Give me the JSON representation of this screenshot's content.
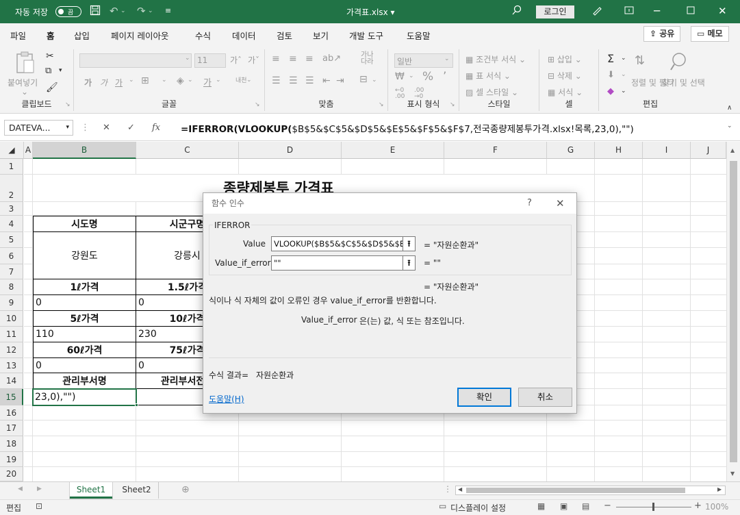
{
  "titlebar": {
    "autosave_label": "자동 저장",
    "autosave_state": "끔",
    "file_title": "가격표.xlsx ▾",
    "login_label": "로그인",
    "accent": "#217346"
  },
  "menu": {
    "tabs": [
      "파일",
      "홈",
      "삽입",
      "페이지 레이아웃",
      "수식",
      "데이터",
      "검토",
      "보기",
      "개발 도구",
      "도움말"
    ],
    "active": "홈",
    "share_label": "공유",
    "memo_label": "메모"
  },
  "ribbon": {
    "clipboard": {
      "paste": "붙여넣기",
      "label": "클립보드"
    },
    "font": {
      "size": "11",
      "label": "글꼴",
      "bold": "가",
      "italic": "가",
      "underline": "가"
    },
    "align": {
      "label": "맞춤"
    },
    "number": {
      "format": "일반",
      "label": "표시 형식"
    },
    "styles": {
      "cond": "조건부 서식",
      "table": "표 서식",
      "cell": "셀 스타일",
      "label": "스타일"
    },
    "cells": {
      "insert": "삽입",
      "delete": "삭제",
      "format": "서식",
      "label": "셀"
    },
    "editing": {
      "sort": "정렬 및 필터",
      "find": "찾기 및 선택",
      "label": "편집"
    }
  },
  "formula_bar": {
    "name_box": "DATEVA...",
    "fx": "fx",
    "formula_parts": [
      {
        "t": "=IFERROR(",
        "bold": true
      },
      {
        "t": "VLOOKUP(",
        "bold": true
      },
      {
        "t": "$B$5&$C$5&$D$5&$E$5&$F$5&$F$7,전국종량제봉투가격.xlsx!목록,23,0),\"\")",
        "bold": false
      }
    ]
  },
  "grid": {
    "columns": [
      "A",
      "B",
      "C",
      "D",
      "E",
      "F",
      "G",
      "H",
      "I",
      "J"
    ],
    "selected_col": "B",
    "rows": [
      "1",
      "2",
      "3",
      "4",
      "5",
      "6",
      "7",
      "8",
      "9",
      "10",
      "11",
      "12",
      "13",
      "14",
      "15",
      "16",
      "17",
      "18",
      "19",
      "20"
    ],
    "selected_row": "15",
    "title": "종량제봉투 가격표",
    "cells": {
      "b4": "시도명",
      "c4": "시군구명",
      "b56": "강원도",
      "c56": "강릉시",
      "b8": "1ℓ가격",
      "c8": "1.5ℓ가격",
      "b9": "0",
      "c9": "0",
      "b10": "5ℓ가격",
      "c10": "10ℓ가격",
      "b11": "110",
      "c11": "230",
      "b12": "60ℓ가격",
      "c12": "75ℓ가격",
      "b13": "0",
      "c13": "0",
      "b14": "관리부서명",
      "c14": "관리부서전화",
      "b15": "23,0),\"\")"
    }
  },
  "sheets": {
    "tabs": [
      "Sheet1",
      "Sheet2"
    ],
    "active": "Sheet1"
  },
  "status": {
    "mode": "편집",
    "display": "디스플레이 설정",
    "zoom": "100%"
  },
  "dialog": {
    "title": "함수 인수",
    "help_glyph": "?",
    "function_name": "IFERROR",
    "arg1_label": "Value",
    "arg1_value": "VLOOKUP($B$5&$C$5&$D$5&$E$5&$F",
    "arg1_result": "=  \"자원순환과\"",
    "arg2_label": "Value_if_error",
    "arg2_value": "\"\"",
    "arg2_result": "=  \"\"",
    "total_result": "=  \"자원순환과\"",
    "description": "식이나 식 자체의 값이 오류인 경우 value_if_error를 반환합니다.",
    "arg_desc_name": "Value_if_error",
    "arg_desc": "은(는) 값, 식 또는 참조입니다.",
    "formula_result_label": "수식 결과=",
    "formula_result_value": "자원순환과",
    "help_link": "도움말(H)",
    "ok_label": "확인",
    "cancel_label": "취소"
  }
}
